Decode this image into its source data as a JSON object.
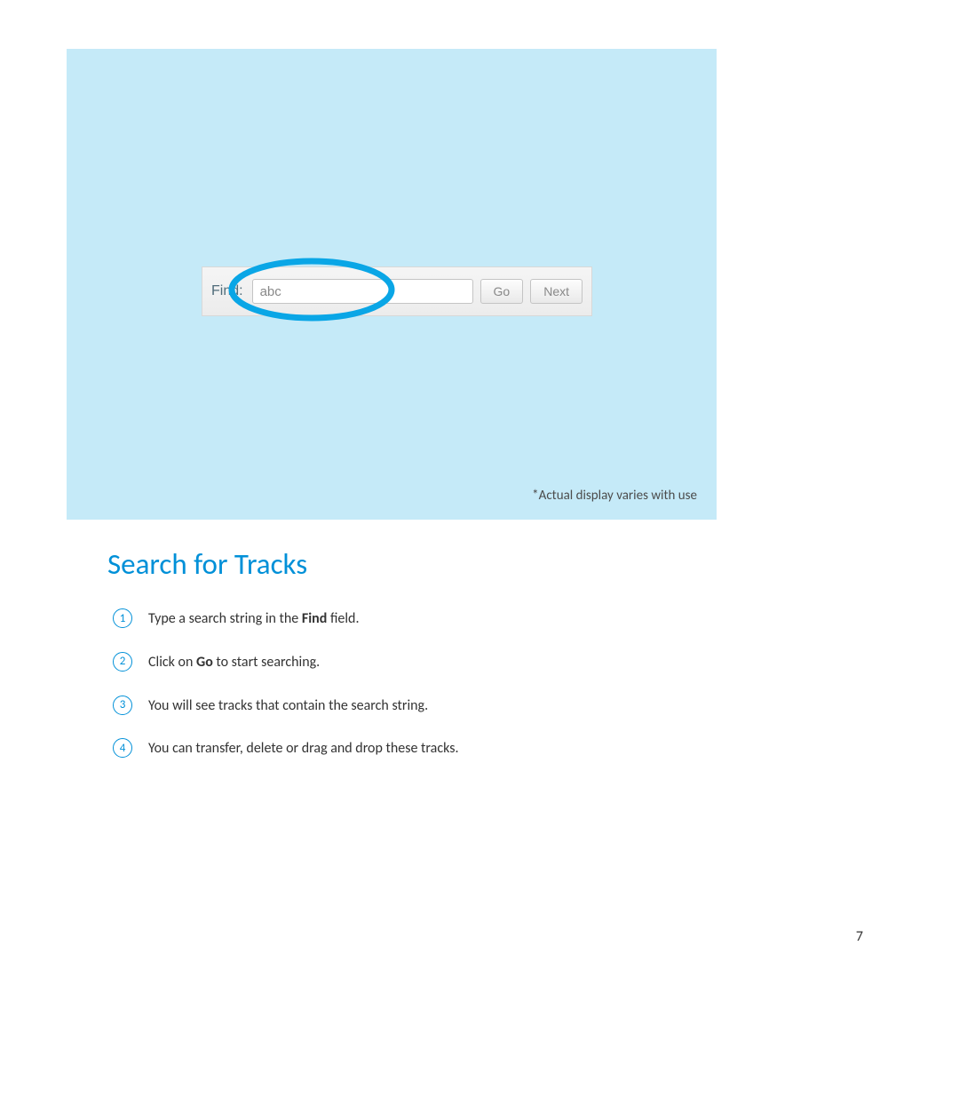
{
  "screenshot": {
    "find_label": "Find:",
    "find_value": "abc",
    "go_label": "Go",
    "next_label": "Next",
    "caption": "*Actual display varies with use"
  },
  "heading": "Search for Tracks",
  "steps": [
    {
      "n": "1",
      "pre": "Type a search string in the ",
      "bold": "Find",
      "post": " field."
    },
    {
      "n": "2",
      "pre": "Click on ",
      "bold": "Go",
      "post": " to start searching."
    },
    {
      "n": "3",
      "pre": "You will see tracks that contain the search string.",
      "bold": "",
      "post": ""
    },
    {
      "n": "4",
      "pre": "You can transfer, delete or drag and drop these tracks.",
      "bold": "",
      "post": ""
    }
  ],
  "page_number": "7"
}
